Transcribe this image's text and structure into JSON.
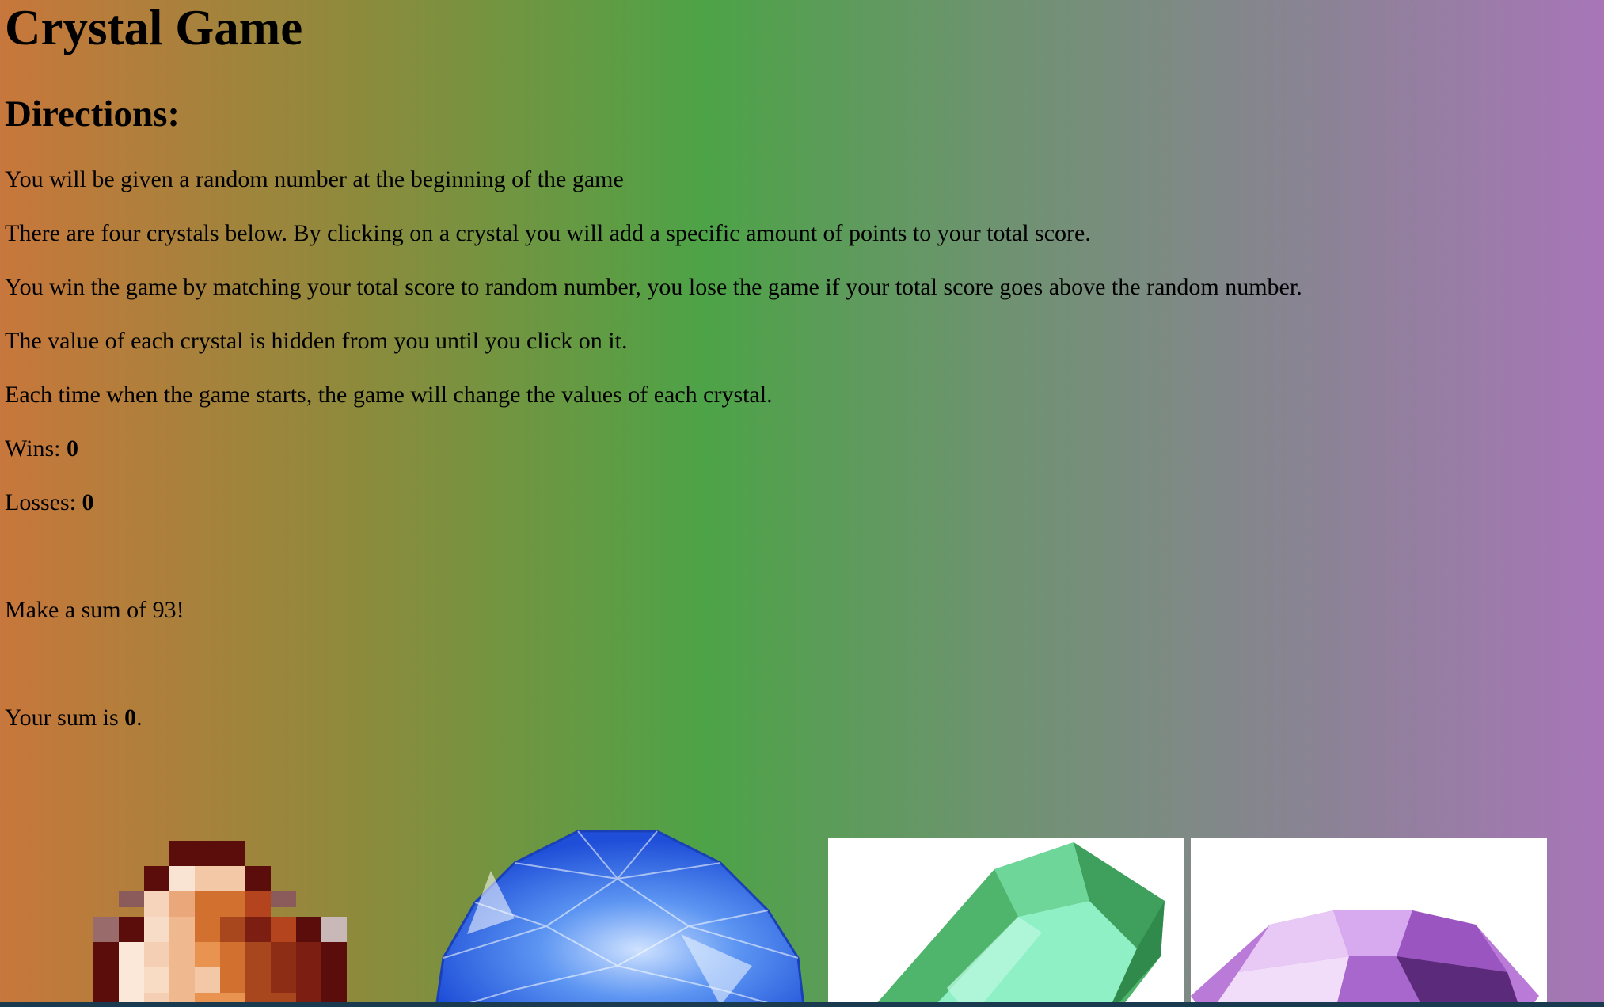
{
  "page": {
    "title": "Crystal Game",
    "directions_heading": "Directions:",
    "directions": [
      "You will be given a random number at the beginning of the game",
      "There are four crystals below. By clicking on a crystal you will add a specific amount of points to your total score.",
      "You win the game by matching your total score to random number, you lose the game if your total score goes above the random number.",
      "The value of each crystal is hidden from you until you click on it.",
      "Each time when the game starts, the game will change the values of each crystal."
    ]
  },
  "stats": {
    "wins_label": "Wins: ",
    "wins_value": "0",
    "losses_label": "Losses: ",
    "losses_value": "0"
  },
  "target": {
    "text": "Make a sum of 93!"
  },
  "sum": {
    "prefix": "Your sum is ",
    "value": "0",
    "suffix": "."
  },
  "crystals": [
    {
      "name": "orange-pixel-crystal",
      "color": "#d2702f"
    },
    {
      "name": "blue-round-crystal",
      "color": "#2f6ef0"
    },
    {
      "name": "green-emerald-crystal",
      "color": "#4cc27a"
    },
    {
      "name": "purple-gem-crystal",
      "color": "#b97ad8"
    }
  ]
}
